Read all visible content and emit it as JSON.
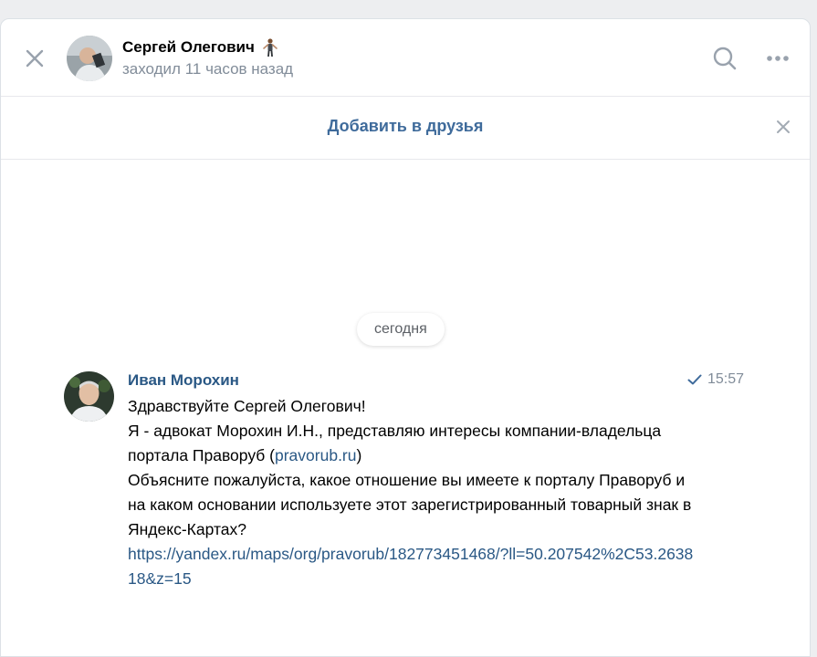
{
  "header": {
    "contact_name": "Сергей Олегович",
    "contact_status": "заходил 11 часов назад",
    "icons": {
      "close": "close-icon",
      "search": "search-icon",
      "more": "more-icon",
      "emoji": "man-standing-emoji-icon"
    }
  },
  "friend_bar": {
    "add_friend_label": "Добавить в друзья"
  },
  "chat": {
    "date_separator": "сегодня",
    "message": {
      "author": "Иван Морохин",
      "time": "15:57",
      "line1": "Здравствуйте Сергей Олегович!",
      "line2_prefix": "Я - адвокат Морохин И.Н., представляю интересы компании-владельца портала Праворуб (",
      "line2_link": "pravorub.ru",
      "line2_suffix": ")",
      "line3": "Объясните пожалуйста, какое отношение вы имеете к порталу Праворуб и на каком основании используете этот зарегистрированный товарный знак в Яндекс-Картах?",
      "url": "https://yandex.ru/maps/org/pravorub/182773451468/?ll=50.207542%2C53.263818&z=15"
    }
  },
  "colors": {
    "accent": "#3f6b9b",
    "link": "#2a5885",
    "muted": "#818c99",
    "background": "#edeef0"
  }
}
